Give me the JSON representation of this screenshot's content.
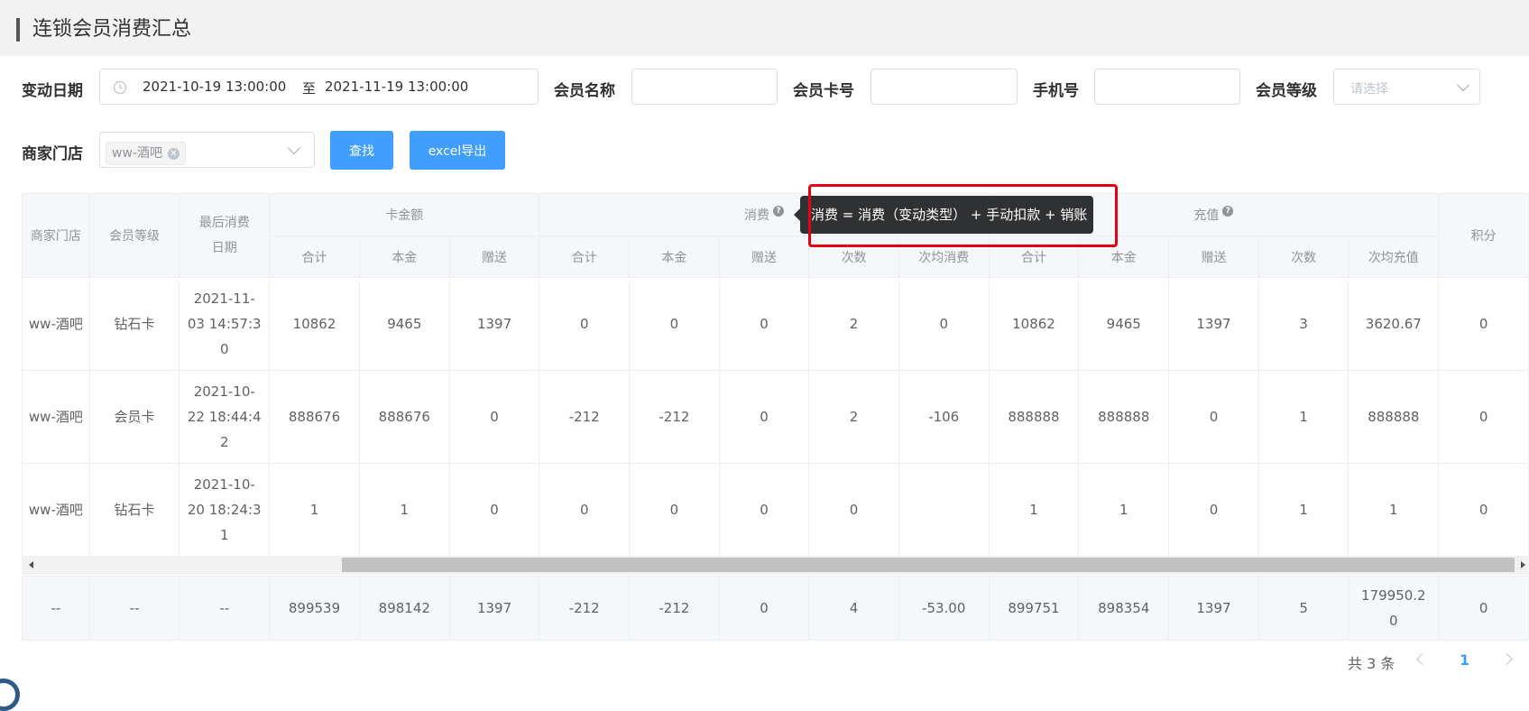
{
  "page": {
    "title": "连锁会员消费汇总"
  },
  "filters": {
    "date_label": "变动日期",
    "date_start": "2021-10-19 13:00:00",
    "date_sep": "至",
    "date_end": "2021-11-19 13:00:00",
    "member_name_label": "会员名称",
    "member_name_value": "",
    "card_no_label": "会员卡号",
    "card_no_value": "",
    "phone_label": "手机号",
    "phone_value": "",
    "level_label": "会员等级",
    "level_placeholder": "请选择",
    "store_label": "商家门店",
    "store_tag": "ww-酒吧",
    "search_button": "查找",
    "export_button": "excel导出"
  },
  "table": {
    "group_headers": {
      "store": "商家门店",
      "level": "会员等级",
      "last_date_1": "最后消费",
      "last_date_2": "日期",
      "card_balance": "卡金额",
      "consumption": "消费",
      "recharge": "充值",
      "points": "积分"
    },
    "sub_headers": {
      "card_total": "合计",
      "card_principal": "本金",
      "card_gift": "赠送",
      "con_total": "合计",
      "con_principal": "本金",
      "con_gift": "赠送",
      "con_count": "次数",
      "con_avg": "次均消费",
      "rec_total": "合计",
      "rec_principal": "本金",
      "rec_gift": "赠送",
      "rec_count": "次数",
      "rec_avg": "次均充值"
    },
    "rows": [
      {
        "store": "ww-酒吧",
        "level": "钻石卡",
        "date_1": "2021-11-",
        "date_2": "03 14:57:3",
        "date_3": "0",
        "card_total": "10862",
        "card_principal": "9465",
        "card_gift": "1397",
        "con_total": "0",
        "con_principal": "0",
        "con_gift": "0",
        "con_count": "2",
        "con_avg": "0",
        "rec_total": "10862",
        "rec_principal": "9465",
        "rec_gift": "1397",
        "rec_count": "3",
        "rec_avg": "3620.67",
        "points": "0"
      },
      {
        "store": "ww-酒吧",
        "level": "会员卡",
        "date_1": "2021-10-",
        "date_2": "22 18:44:4",
        "date_3": "2",
        "card_total": "888676",
        "card_principal": "888676",
        "card_gift": "0",
        "con_total": "-212",
        "con_principal": "-212",
        "con_gift": "0",
        "con_count": "2",
        "con_avg": "-106",
        "rec_total": "888888",
        "rec_principal": "888888",
        "rec_gift": "0",
        "rec_count": "1",
        "rec_avg": "888888",
        "points": "0"
      },
      {
        "store": "ww-酒吧",
        "level": "钻石卡",
        "date_1": "2021-10-",
        "date_2": "20 18:24:3",
        "date_3": "1",
        "card_total": "1",
        "card_principal": "1",
        "card_gift": "0",
        "con_total": "0",
        "con_principal": "0",
        "con_gift": "0",
        "con_count": "0",
        "con_avg": "",
        "rec_total": "1",
        "rec_principal": "1",
        "rec_gift": "0",
        "rec_count": "1",
        "rec_avg": "1",
        "points": "0"
      }
    ],
    "footer": {
      "store": "--",
      "level": "--",
      "date": "--",
      "card_total": "899539",
      "card_principal": "898142",
      "card_gift": "1397",
      "con_total": "-212",
      "con_principal": "-212",
      "con_gift": "0",
      "con_count": "4",
      "con_avg": "-53.00",
      "rec_total": "899751",
      "rec_principal": "898354",
      "rec_gift": "1397",
      "rec_count": "5",
      "rec_avg_1": "179950.2",
      "rec_avg_2": "0",
      "points": "0"
    }
  },
  "tooltip": {
    "text": "消费 = 消费（变动类型） + 手动扣款 + 销账"
  },
  "pagination": {
    "total_text": "共 3 条",
    "current_page": "1"
  },
  "icons": {
    "clock": "clock-icon",
    "chevron": "chevron-down-icon",
    "close": "close-circle-icon",
    "help": "question-circle-icon",
    "prev": "chevron-left-icon",
    "next": "chevron-right-icon"
  },
  "colors": {
    "primary": "#409eff",
    "header_bg": "#f5f7fa",
    "tooltip_bg": "#303133",
    "highlight": "#e60012"
  }
}
